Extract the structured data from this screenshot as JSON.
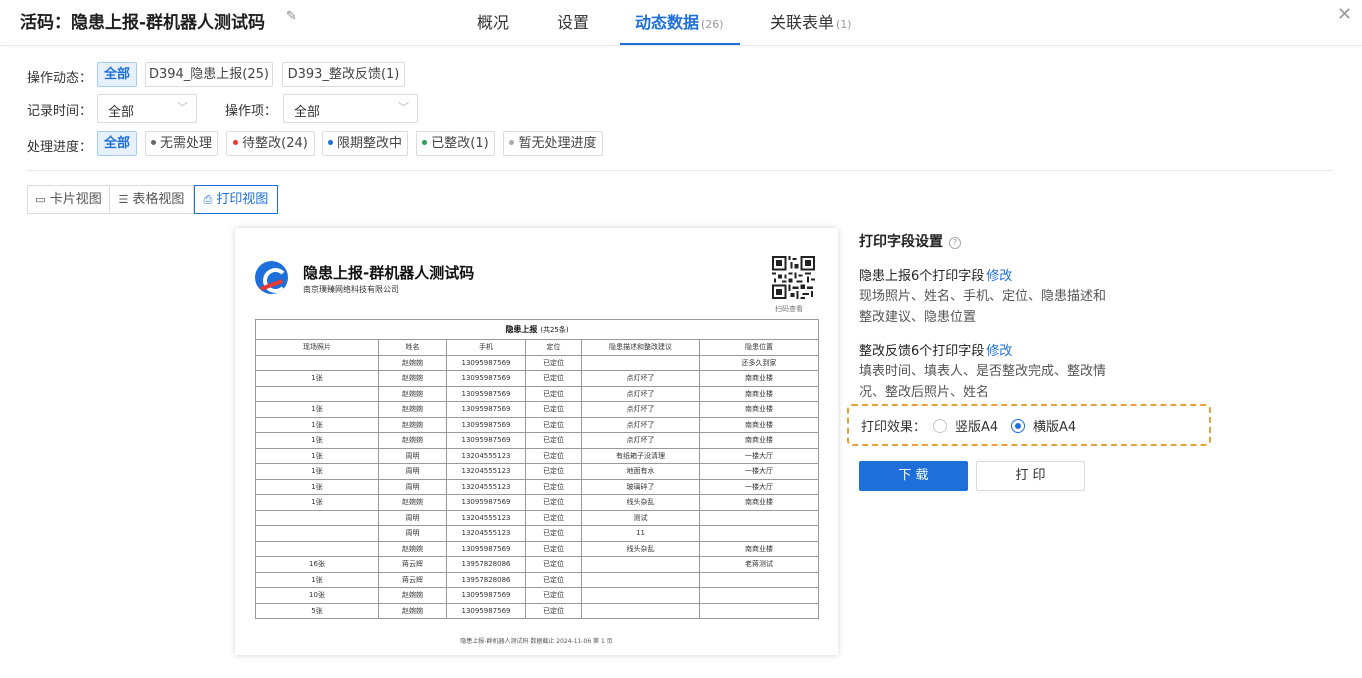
{
  "header": {
    "title": "活码：隐患上报-群机器人测试码",
    "tabs": [
      {
        "label": "概况",
        "count": ""
      },
      {
        "label": "设置",
        "count": ""
      },
      {
        "label": "动态数据",
        "count": "(26)"
      },
      {
        "label": "关联表单",
        "count": "(1)"
      }
    ],
    "active_tab": "动态数据"
  },
  "filters": {
    "action_label": "操作动态：",
    "action_chips": [
      "全部",
      "D394_隐患上报(25)",
      "D393_整改反馈(1)"
    ],
    "time_label": "记录时间：",
    "time_value": "全部",
    "op_label": "操作项：",
    "op_value": "全部",
    "progress_label": "处理进度：",
    "progress_chips": [
      {
        "label": "全部",
        "color": ""
      },
      {
        "label": "无需处理",
        "color": "#666666"
      },
      {
        "label": "待整改(24)",
        "color": "#e53935"
      },
      {
        "label": "限期整改中",
        "color": "#1e6fd9"
      },
      {
        "label": "已整改(1)",
        "color": "#2e9e5b"
      },
      {
        "label": "暂无处理进度",
        "color": "#aaaaaa"
      }
    ]
  },
  "views": [
    {
      "label": "卡片视图",
      "icon": "card-icon"
    },
    {
      "label": "表格视图",
      "icon": "list-icon"
    },
    {
      "label": "打印视图",
      "icon": "printer-icon"
    }
  ],
  "preview": {
    "title": "隐患上报-群机器人测试码",
    "company": "南京璞臻网络科技有限公司",
    "qr_caption": "扫码查看",
    "table_title": "隐患上报",
    "table_count": "(共25条)",
    "columns": [
      "现场照片",
      "姓名",
      "手机",
      "定位",
      "隐患描述和整改建议",
      "隐患位置"
    ],
    "rows": [
      [
        "",
        "赵婉婉",
        "13095987569",
        "已定位",
        "",
        "还多久到家"
      ],
      [
        "1张",
        "赵婉婉",
        "13095987569",
        "已定位",
        "点灯坏了",
        "南商业楼"
      ],
      [
        "",
        "赵婉婉",
        "13095987569",
        "已定位",
        "点灯坏了",
        "南商业楼"
      ],
      [
        "1张",
        "赵婉婉",
        "13095987569",
        "已定位",
        "点灯坏了",
        "南商业楼"
      ],
      [
        "1张",
        "赵婉婉",
        "13095987569",
        "已定位",
        "点灯坏了",
        "南商业楼"
      ],
      [
        "1张",
        "赵婉婉",
        "13095987569",
        "已定位",
        "点灯坏了",
        "南商业楼"
      ],
      [
        "1张",
        "周明",
        "13204555123",
        "已定位",
        "有纸箱子没清理",
        "一楼大厅"
      ],
      [
        "1张",
        "周明",
        "13204555123",
        "已定位",
        "地面有水",
        "一楼大厅"
      ],
      [
        "1张",
        "周明",
        "13204555123",
        "已定位",
        "玻璃碎了",
        "一楼大厅"
      ],
      [
        "1张",
        "赵婉婉",
        "13095987569",
        "已定位",
        "线头杂乱",
        "南商业楼"
      ],
      [
        "",
        "周明",
        "13204555123",
        "已定位",
        "测试",
        ""
      ],
      [
        "",
        "周明",
        "13204555123",
        "已定位",
        "11",
        ""
      ],
      [
        "",
        "赵婉婉",
        "13095987569",
        "已定位",
        "线头杂乱",
        "南商业楼"
      ],
      [
        "16张",
        "蒋云辉",
        "13957828086",
        "已定位",
        "",
        "老蒋测试"
      ],
      [
        "1张",
        "蒋云辉",
        "13957828086",
        "已定位",
        "",
        ""
      ],
      [
        "10张",
        "赵婉婉",
        "13095987569",
        "已定位",
        "",
        ""
      ],
      [
        "5张",
        "赵婉婉",
        "13095987569",
        "已定位",
        "",
        ""
      ]
    ],
    "footer": "隐患上报-群机器人测试码    数据截止 2024-11-06    第 1 页"
  },
  "settings": {
    "title": "打印字段设置",
    "section1_head": "隐患上报6个打印字段",
    "section1_link": "修改",
    "section1_body": "现场照片、姓名、手机、定位、隐患描述和整改建议、隐患位置",
    "section2_head": "整改反馈6个打印字段",
    "section2_link": "修改",
    "section2_body": "填表时间、填表人、是否整改完成、整改情况、整改后照片、姓名",
    "effect_label": "打印效果：",
    "option_portrait": "竖版A4",
    "option_landscape": "横版A4",
    "selected": "横版A4",
    "download": "下 载",
    "print": "打 印"
  }
}
